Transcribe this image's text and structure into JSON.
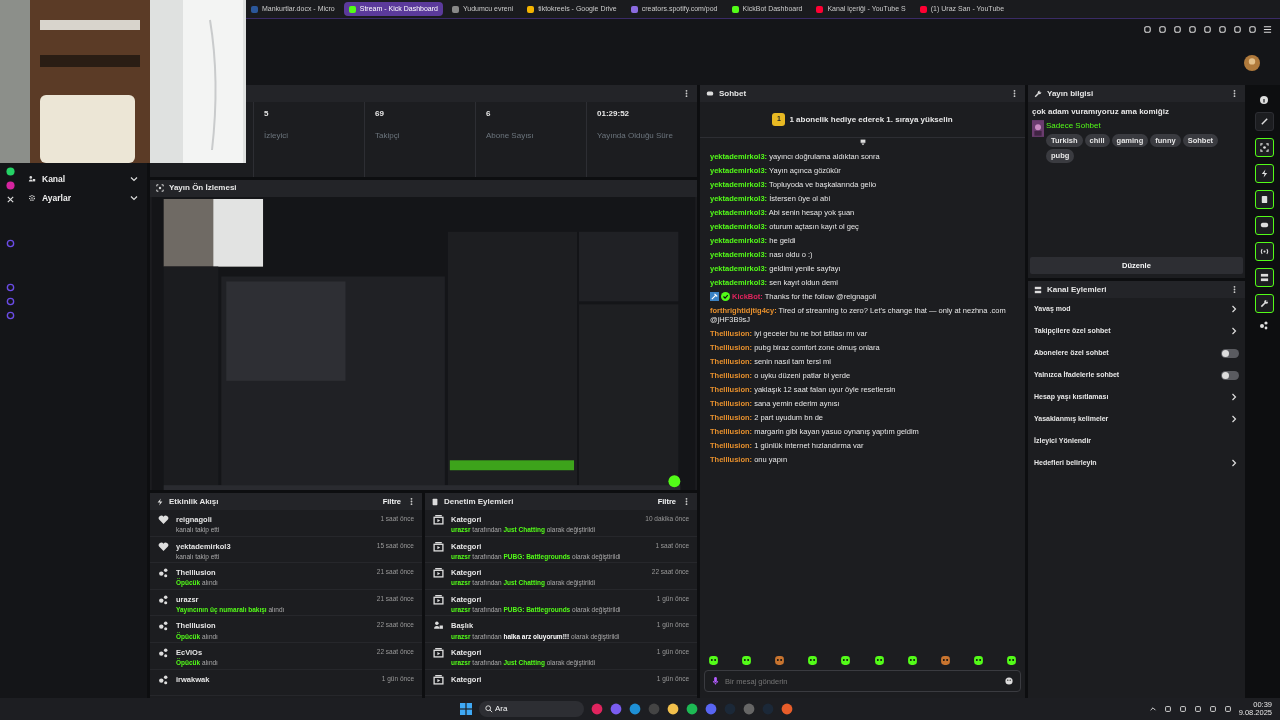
{
  "browser": {
    "tabs": [
      {
        "label": "Mankurtlar.docx - Micro",
        "selected": false,
        "color": "#2b579a"
      },
      {
        "label": "Stream - Kick Dashboard",
        "selected": true,
        "color": "#53fc18"
      },
      {
        "label": "Yudumcu evreni",
        "selected": false,
        "color": "#888888"
      },
      {
        "label": "tiktokreels - Google Drive",
        "selected": false,
        "color": "#f4b400"
      },
      {
        "label": "creators.spotify.com/pod",
        "selected": false,
        "color": "#8b6be0"
      },
      {
        "label": "KickBot Dashboard",
        "selected": false,
        "color": "#53fc18"
      },
      {
        "label": "Kanal içeriği - YouTube S",
        "selected": false,
        "color": "#ff0033"
      },
      {
        "label": "(1) Uraz San - YouTube",
        "selected": false,
        "color": "#ff0033"
      }
    ]
  },
  "sidebar": {
    "items": [
      {
        "label": "Kanal",
        "expanded": false
      },
      {
        "label": "Ayarlar",
        "expanded": false
      }
    ]
  },
  "stats": [
    {
      "value": "5",
      "label": "İzleyici"
    },
    {
      "value": "69",
      "label": "Takipçi"
    },
    {
      "value": "6",
      "label": "Abone Sayısı"
    },
    {
      "value": "01:29:52",
      "label": "Yayında Olduğu Süre"
    }
  ],
  "preview": {
    "title": "Yayın Ön İzlemesi"
  },
  "activity": {
    "title": "Etkinlik Akışı",
    "filter": "Filtre",
    "items": [
      {
        "kind": "follow",
        "user": "reignagoli",
        "text": "kanalı takip etti",
        "time": "1 saat önce"
      },
      {
        "kind": "follow",
        "user": "yektademirkol3",
        "text": "kanalı takip etti",
        "time": "15 saat önce"
      },
      {
        "kind": "reward",
        "user": "TheIllusion",
        "highlight": "Öpücük",
        "text": "alındı",
        "time": "21 saat önce"
      },
      {
        "kind": "reward",
        "user": "urazsr",
        "highlight": "Yayıncının üç numaralı bakışı",
        "text": "alındı",
        "time": "21 saat önce"
      },
      {
        "kind": "reward",
        "user": "TheIllusion",
        "highlight": "Öpücük",
        "text": "alındı",
        "time": "22 saat önce"
      },
      {
        "kind": "reward",
        "user": "EcViOs",
        "highlight": "Öpücük",
        "text": "alındı",
        "time": "22 saat önce"
      },
      {
        "kind": "reward",
        "user": "irwakwak",
        "time": "1 gün önce"
      }
    ]
  },
  "moderation": {
    "title": "Denetim Eylemleri",
    "filter": "Filtre",
    "items": [
      {
        "kind": "category",
        "title": "Kategori",
        "user": "urazsr",
        "by": "tarafından",
        "value": "Just Chatting",
        "end": "olarak değiştirildi",
        "time": "10 dakika önce"
      },
      {
        "kind": "category",
        "title": "Kategori",
        "user": "urazsr",
        "by": "tarafından",
        "value": "PUBG: Battlegrounds",
        "end": "olarak değiştirildi",
        "time": "1 saat önce"
      },
      {
        "kind": "category",
        "title": "Kategori",
        "user": "urazsr",
        "by": "tarafından",
        "value": "Just Chatting",
        "end": "olarak değiştirildi",
        "time": "22 saat önce"
      },
      {
        "kind": "category",
        "title": "Kategori",
        "user": "urazsr",
        "by": "tarafından",
        "value": "PUBG: Battlegrounds",
        "end": "olarak değiştirildi",
        "time": "1 gün önce"
      },
      {
        "kind": "title",
        "title": "Başlık",
        "user": "urazsr",
        "by": "tarafından",
        "value": "halka arz oluyorum!!!",
        "end": "olarak değiştirildi",
        "time": "1 gün önce"
      },
      {
        "kind": "category",
        "title": "Kategori",
        "user": "urazsr",
        "by": "tarafından",
        "value": "Just Chatting",
        "end": "olarak değiştirildi",
        "time": "1 gün önce"
      },
      {
        "kind": "category",
        "title": "Kategori",
        "time": "1 gün önce"
      }
    ]
  },
  "chat": {
    "title": "Sohbet",
    "banner_badge": "1",
    "banner": "1 abonelik hediye ederek 1. sıraya yükselin",
    "messages": [
      {
        "user": "yektademirkol3:",
        "color": "#53fc18",
        "text": "yayıncı doğrulama aldıktan sonra"
      },
      {
        "user": "yektademirkol3:",
        "color": "#53fc18",
        "text": "Yayın açınca gözükür"
      },
      {
        "user": "yektademirkol3:",
        "color": "#53fc18",
        "text": "Topluyoda ve başkalarında gelio"
      },
      {
        "user": "yektademirkol3:",
        "color": "#53fc18",
        "text": "İstersen üye ol abi"
      },
      {
        "user": "yektademirkol3:",
        "color": "#53fc18",
        "text": "Abi senin hesap yok şuan"
      },
      {
        "user": "yektademirkol3:",
        "color": "#53fc18",
        "text": "oturum açtasın kayıt ol geç"
      },
      {
        "user": "yektademirkol3:",
        "color": "#53fc18",
        "text": "he geldi"
      },
      {
        "user": "yektademirkol3:",
        "color": "#53fc18",
        "text": "nası oldu o :)"
      },
      {
        "user": "yektademirkol3:",
        "color": "#53fc18",
        "text": "geldimi yenile sayfayı"
      },
      {
        "user": "yektademirkol3:",
        "color": "#53fc18",
        "text": "sen kayıt oldun demi"
      },
      {
        "user": "KickBot:",
        "color": "#e0245e",
        "kind": "bot",
        "text": "Thanks for the follow @reignagoli"
      },
      {
        "user": "forthrightidjtig4cy:",
        "color": "#e8912d",
        "text": "Tired of streaming to zero? Let's change that — only at nezhna .com @jHF3B9sJ"
      },
      {
        "user": "TheIllusion:",
        "color": "#e8912d",
        "text": "iyi geceler bu ne bot istilası mı var"
      },
      {
        "user": "TheIllusion:",
        "color": "#e8912d",
        "text": "pubg biraz comfort zone olmuş onlara"
      },
      {
        "user": "TheIllusion:",
        "color": "#e8912d",
        "text": "senin nasıl tam tersi mi"
      },
      {
        "user": "TheIllusion:",
        "color": "#e8912d",
        "text": "o uyku düzeni patlar bi yerde"
      },
      {
        "user": "TheIllusion:",
        "color": "#e8912d",
        "text": "yaklaşık 12 saat falan uyur öyle resetlersin"
      },
      {
        "user": "TheIllusion:",
        "color": "#e8912d",
        "text": "sana yemin ederim aynısı"
      },
      {
        "user": "TheIllusion:",
        "color": "#e8912d",
        "text": "2 part uyudum bn de"
      },
      {
        "user": "TheIllusion:",
        "color": "#e8912d",
        "text": "margarin gibi kayan yasuo oynanış yaptım geldim"
      },
      {
        "user": "TheIllusion:",
        "color": "#e8912d",
        "text": "1 günlük internet hızlandırma var"
      },
      {
        "user": "TheIllusion:",
        "color": "#e8912d",
        "text": "onu yapın"
      }
    ],
    "input": {
      "placeholder": "Bir mesaj gönderin"
    }
  },
  "stream_info": {
    "title": "Yayın bilgisi",
    "stream_title": "çok adam vuramıyoruz ama komiğiz",
    "category": "Sadece Sohbet",
    "tags": [
      "Turkish",
      "chill",
      "gaming",
      "funny",
      "Sohbet",
      "pubg"
    ],
    "edit": "Düzenle"
  },
  "channel_actions": {
    "title": "Kanal Eylemleri",
    "items": [
      {
        "kind": "link",
        "label": "Yavaş mod"
      },
      {
        "kind": "link",
        "label": "Takipçilere özel sohbet"
      },
      {
        "kind": "toggle",
        "label": "Abonelere özel sohbet",
        "on": false
      },
      {
        "kind": "toggle",
        "label": "Yalnızca İfadelerle sohbet",
        "on": false
      },
      {
        "kind": "link",
        "label": "Hesap yaşı kısıtlaması"
      },
      {
        "kind": "link",
        "label": "Yasaklanmış kelimeler"
      },
      {
        "kind": "plain",
        "label": "İzleyici Yönlendir"
      },
      {
        "kind": "link",
        "label": "Hedefleri belirleyin"
      }
    ]
  },
  "taskbar": {
    "search": "Ara",
    "time": "00:39",
    "date": "9.08.2025"
  }
}
